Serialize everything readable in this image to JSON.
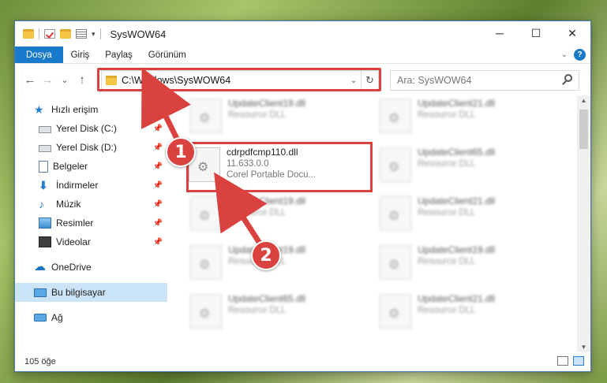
{
  "window": {
    "title": "SysWOW64",
    "controls": {
      "minimize": "─",
      "maximize": "☐",
      "close": "✕"
    }
  },
  "ribbon": {
    "tabs": [
      {
        "label": "Dosya",
        "active": true
      },
      {
        "label": "Giriş"
      },
      {
        "label": "Paylaş"
      },
      {
        "label": "Görünüm"
      }
    ],
    "help": "?"
  },
  "navigation": {
    "back": "←",
    "forward": "→",
    "recent": "⌄",
    "up": "↑",
    "address_path": "C:\\Windows\\SysWOW64",
    "refresh": "↻",
    "search_placeholder": "Ara: SysWOW64"
  },
  "sidebar": {
    "items": [
      {
        "label": "Hızlı erişim",
        "icon": "star-icon",
        "pinned": false
      },
      {
        "label": "Yerel Disk (C:)",
        "icon": "disk-icon",
        "pinned": true
      },
      {
        "label": "Yerel Disk (D:)",
        "icon": "disk-icon",
        "pinned": true
      },
      {
        "label": "Belgeler",
        "icon": "documents-icon",
        "pinned": true
      },
      {
        "label": "İndirmeler",
        "icon": "download-icon",
        "pinned": true
      },
      {
        "label": "Müzik",
        "icon": "music-icon",
        "pinned": true
      },
      {
        "label": "Resimler",
        "icon": "pictures-icon",
        "pinned": true
      },
      {
        "label": "Videolar",
        "icon": "videos-icon",
        "pinned": true
      },
      {
        "label": "OneDrive",
        "icon": "onedrive-icon",
        "pinned": false
      },
      {
        "label": "Bu bilgisayar",
        "icon": "computer-icon",
        "pinned": false,
        "selected": true
      },
      {
        "label": "Ağ",
        "icon": "network-icon",
        "pinned": false
      }
    ]
  },
  "files": [
    {
      "name": "UpdateClient19.dll",
      "detail": "Resource DLL",
      "blurred": true
    },
    {
      "name": "UpdateClient21.dll",
      "detail": "Resource DLL",
      "blurred": true
    },
    {
      "name": "cdrpdfcmp110.dll",
      "version": "11.633.0.0",
      "detail": "Corel Portable Docu...",
      "highlighted": true
    },
    {
      "name": "UpdateClient65.dll",
      "detail": "Resource DLL",
      "blurred": true
    },
    {
      "name": "UpdateClient19.dll",
      "detail": "Resource DLL",
      "blurred": true
    },
    {
      "name": "UpdateClient21.dll",
      "detail": "Resource DLL",
      "blurred": true
    },
    {
      "name": "UpdateClient19.dll",
      "detail": "Resource DLL",
      "blurred": true
    },
    {
      "name": "UpdateClient19.dll",
      "detail": "Resource DLL",
      "blurred": true
    },
    {
      "name": "UpdateClient65.dll",
      "detail": "Resource DLL",
      "blurred": true
    },
    {
      "name": "UpdateClient21.dll",
      "detail": "Resource DLL",
      "blurred": true
    }
  ],
  "status": {
    "item_count": "105 öğe"
  },
  "annotations": {
    "step1": "1",
    "step2": "2",
    "color": "#d9423f"
  }
}
